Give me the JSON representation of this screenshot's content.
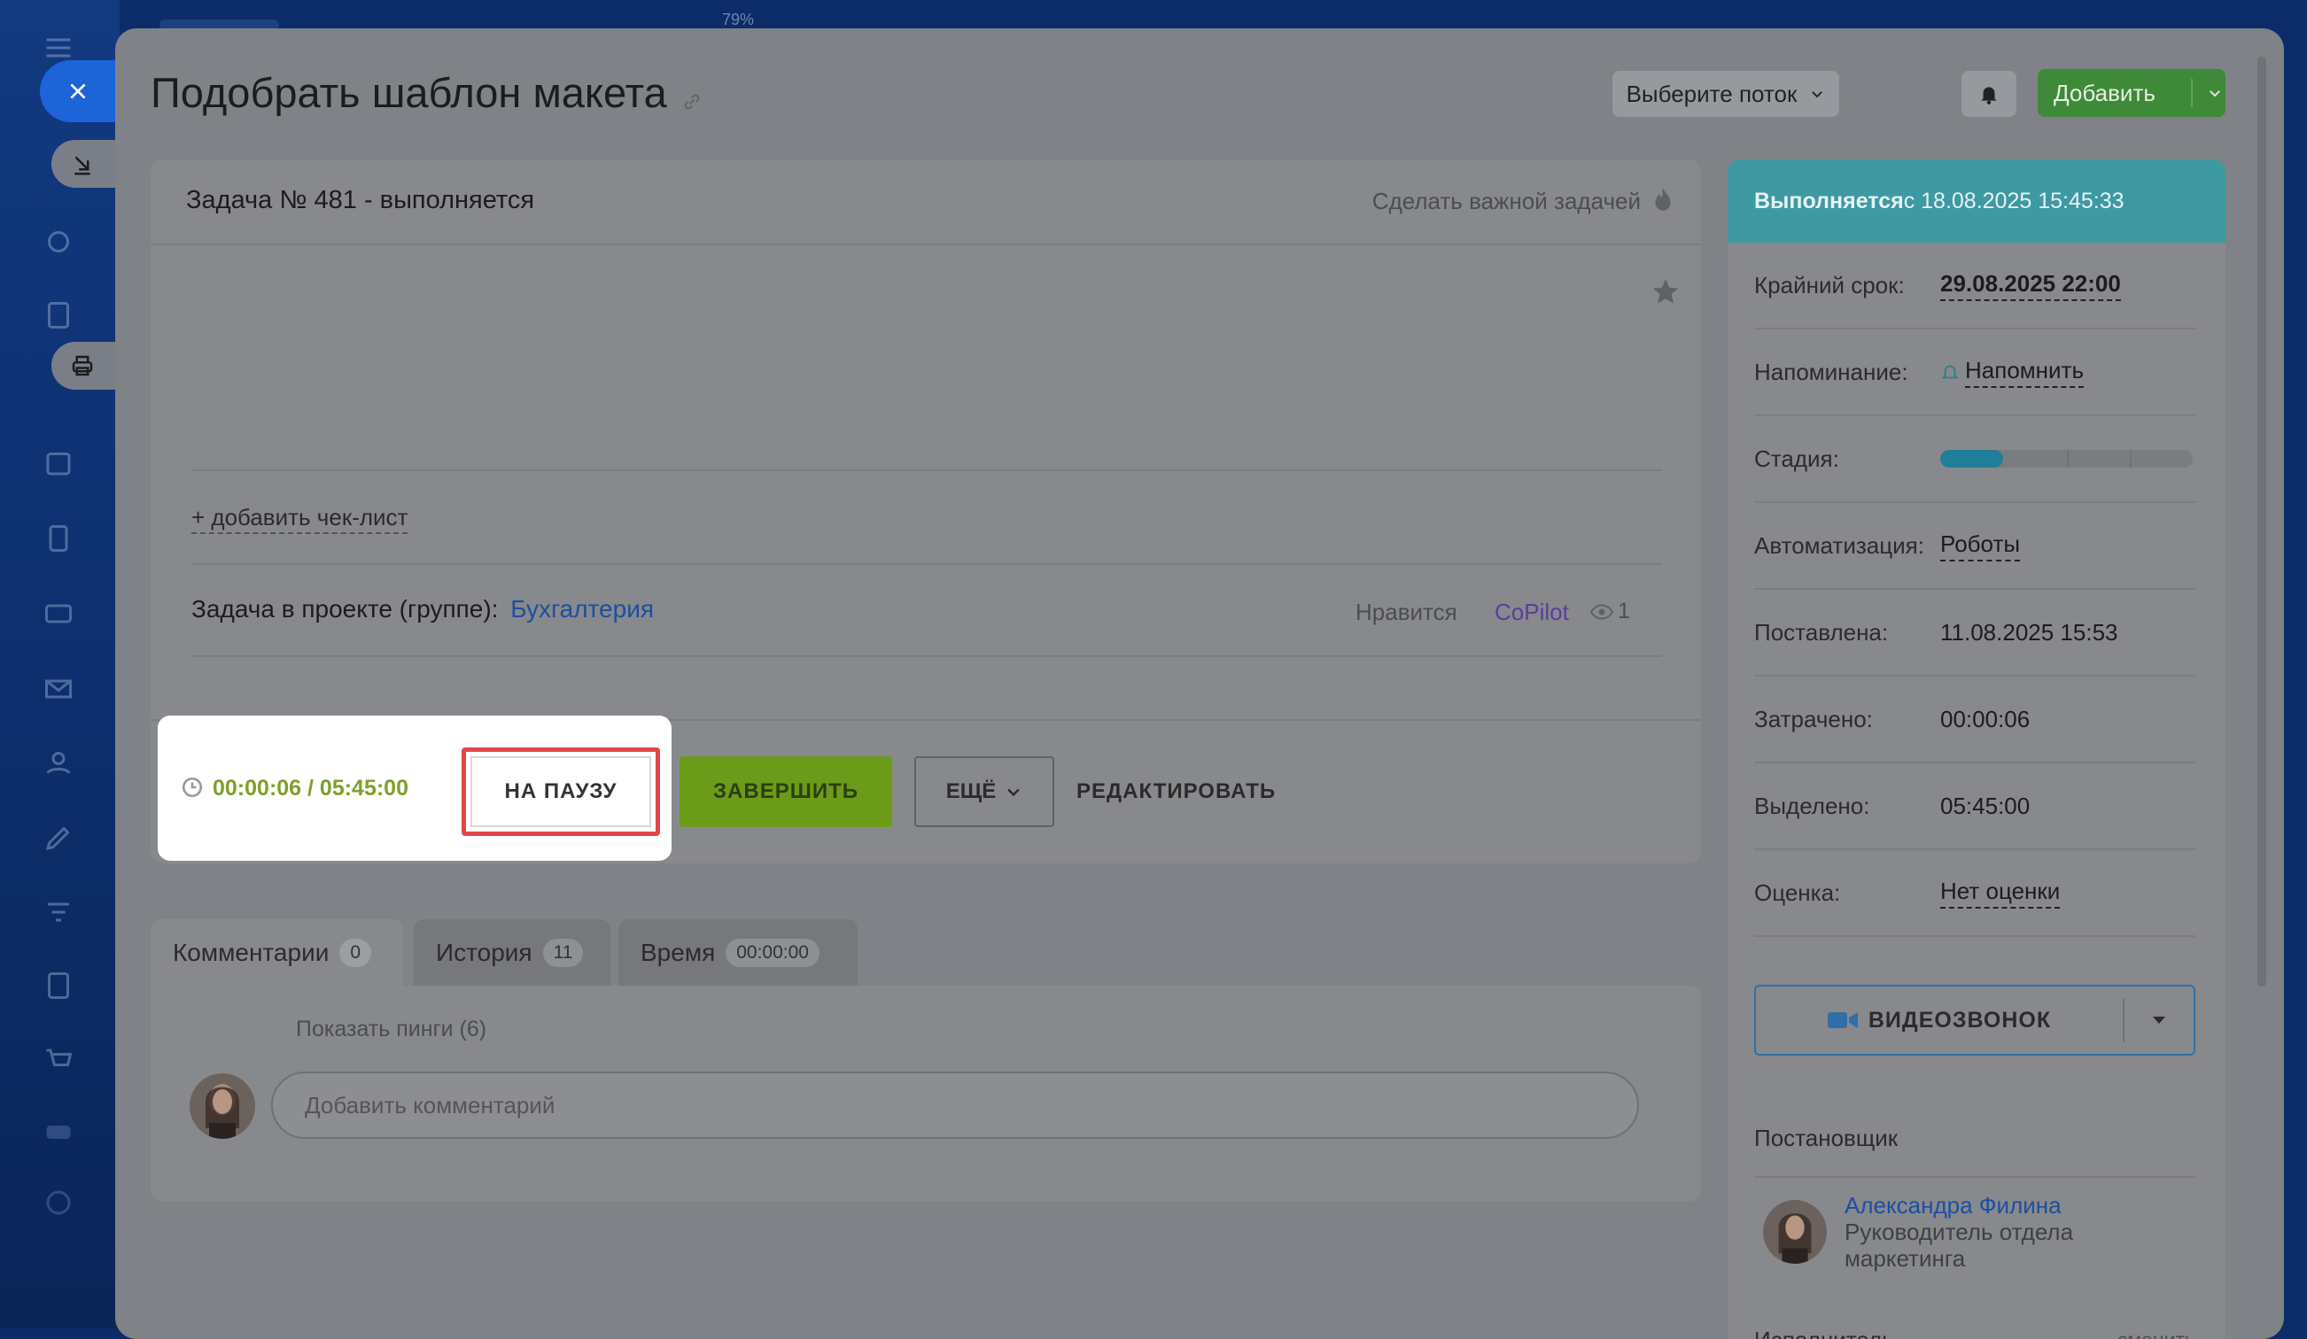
{
  "zoom": "79%",
  "title": "Подобрать шаблон макета",
  "header": {
    "flow_select": "Выберите поток",
    "add_label": "Добавить"
  },
  "task": {
    "heading": "Задача № 481 - выполняется",
    "make_important": "Сделать важной задачей",
    "add_checklist": "+ добавить чек-лист",
    "project_label": "Задача в проекте (группе):",
    "project_name": "Бухгалтерия",
    "likes": "Нравится",
    "copilot": "CoPilot",
    "views": "1"
  },
  "timer": {
    "value": "00:00:06 / 05:45:00"
  },
  "actions": {
    "pause": "НА ПАУЗУ",
    "finish": "ЗАВЕРШИТЬ",
    "more": "ЕЩЁ",
    "edit": "РЕДАКТИРОВАТЬ"
  },
  "tabs": [
    {
      "label": "Комментарии",
      "badge": "0"
    },
    {
      "label": "История",
      "badge": "11"
    },
    {
      "label": "Время",
      "badge": "00:00:00"
    }
  ],
  "comments": {
    "show_pings": "Показать пинги (6)",
    "placeholder": "Добавить комментарий"
  },
  "side": {
    "status_bold": "Выполняется",
    "status_rest": " с 18.08.2025 15:45:33",
    "deadline_label": "Крайний срок:",
    "deadline_value": "29.08.2025 22:00",
    "reminder_label": "Напоминание:",
    "reminder_value": "Напомнить",
    "stage_label": "Стадия:",
    "stage_progress": 0.25,
    "automation_label": "Автоматизация:",
    "automation_value": "Роботы",
    "created_label": "Поставлена:",
    "created_value": "11.08.2025 15:53",
    "spent_label": "Затрачено:",
    "spent_value": "00:00:06",
    "allotted_label": "Выделено:",
    "allotted_value": "05:45:00",
    "rating_label": "Оценка:",
    "rating_value": "Нет оценки",
    "video_call": "ВИДЕОЗВОНОК",
    "creator_section": "Постановщик",
    "creator_name": "Александра Филина",
    "creator_role_1": "Руководитель отдела",
    "creator_role_2": "маркетинга",
    "assignee_section": "Исполнитель",
    "change_label": "сменить"
  },
  "colors": {
    "status_bar": "#3e99a2",
    "finish_button": "#6b9b19",
    "add_button": "#3e8a38",
    "timer_text": "#7ea02a",
    "link_blue": "#1c4fa0",
    "highlight_red": "#e34646"
  }
}
